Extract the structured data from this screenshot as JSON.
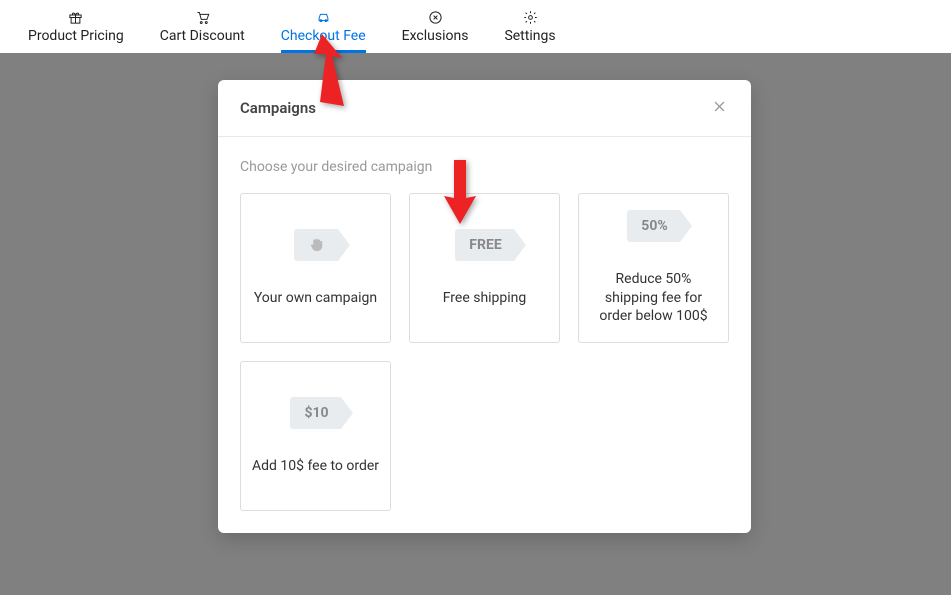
{
  "tabs": [
    {
      "label": "Product Pricing"
    },
    {
      "label": "Cart Discount"
    },
    {
      "label": "Checkout Fee"
    },
    {
      "label": "Exclusions"
    },
    {
      "label": "Settings"
    }
  ],
  "modal": {
    "title": "Campaigns",
    "subtitle": "Choose your desired campaign",
    "campaigns": [
      {
        "tag": "",
        "label": "Your own campaign"
      },
      {
        "tag": "FREE",
        "label": "Free shipping"
      },
      {
        "tag": "50%",
        "label": "Reduce 50% shipping fee for order below 100$"
      },
      {
        "tag": "$10",
        "label": "Add 10$ fee to order"
      }
    ]
  }
}
